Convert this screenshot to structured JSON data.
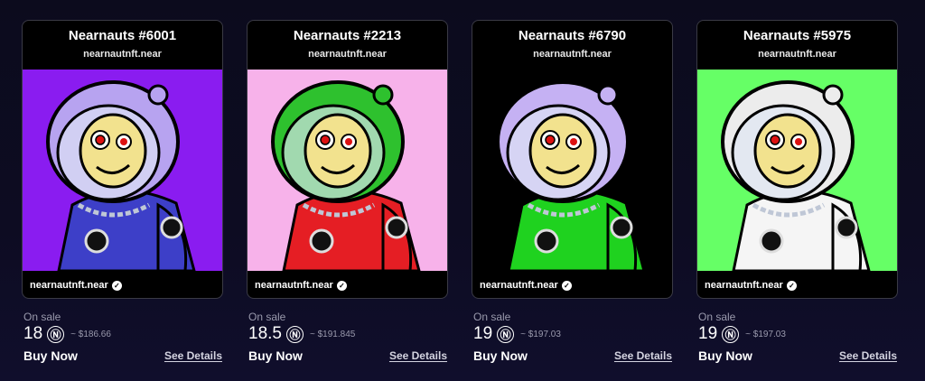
{
  "cards": [
    {
      "title": "Nearnauts #6001",
      "collection": "nearnautnft.near",
      "owner": "nearnautnft.near",
      "status": "On sale",
      "price": "18",
      "usd": "~ $186.66",
      "buy_label": "Buy Now",
      "details_label": "See Details",
      "colors": {
        "background": "#8a1cf0",
        "helmet": "#b7a3f0",
        "suit": "#3d3fc8",
        "face": "#f2e28e"
      }
    },
    {
      "title": "Nearnauts #2213",
      "collection": "nearnautnft.near",
      "owner": "nearnautnft.near",
      "status": "On sale",
      "price": "18.5",
      "usd": "~ $191.845",
      "buy_label": "Buy Now",
      "details_label": "See Details",
      "colors": {
        "background": "#f7b2ea",
        "helmet": "#2ec12e",
        "suit": "#e51e24",
        "face": "#f2e28e"
      }
    },
    {
      "title": "Nearnauts #6790",
      "collection": "nearnautnft.near",
      "owner": "nearnautnft.near",
      "status": "On sale",
      "price": "19",
      "usd": "~ $197.03",
      "buy_label": "Buy Now",
      "details_label": "See Details",
      "colors": {
        "background": "#000000",
        "helmet": "#c5b1f3",
        "suit": "#1fd21f",
        "face": "#f2e28e"
      }
    },
    {
      "title": "Nearnauts #5975",
      "collection": "nearnautnft.near",
      "owner": "nearnautnft.near",
      "status": "On sale",
      "price": "19",
      "usd": "~ $197.03",
      "buy_label": "Buy Now",
      "details_label": "See Details",
      "colors": {
        "background": "#66ff66",
        "helmet": "#ececec",
        "suit": "#f5f5f5",
        "face": "#f2e28e"
      }
    }
  ],
  "near_symbol": "Ⓝ",
  "verified_icon": "verified-check-icon"
}
